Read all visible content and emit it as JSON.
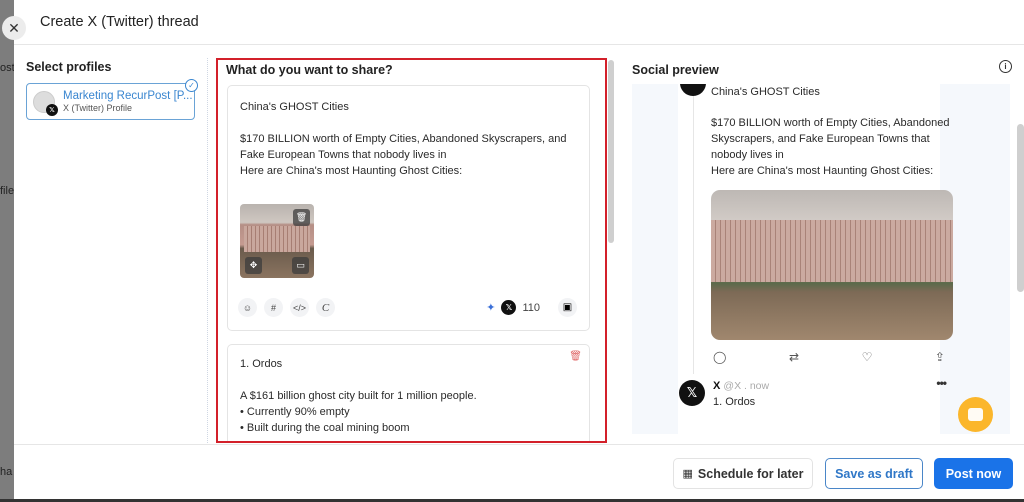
{
  "backdrop": {
    "fragments": [
      "ost",
      "file",
      "ha"
    ]
  },
  "modal": {
    "title": "Create X (Twitter) thread",
    "close_icon": "✕"
  },
  "profiles": {
    "section_title": "Select profiles",
    "items": [
      {
        "name": "Marketing RecurPost [P...",
        "type": "X (Twitter) Profile",
        "selected": true
      }
    ]
  },
  "composer": {
    "section_title": "What do you want to share?",
    "posts": [
      {
        "text": "China's GHOST Cities\n\n$170 BILLION worth of Empty Cities, Abandoned Skyscrapers, and Fake European Towns that nobody lives in\nHere are China's most Haunting Ghost Cities:",
        "char_count": "110",
        "tools": [
          "emoji-icon",
          "hashtag-icon",
          "code-icon",
          "canva-icon"
        ]
      },
      {
        "text": "1. Ordos\n\nA $161 billion ghost city built for 1 million people.\n• Currently 90% empty\n• Built during the coal mining boom"
      }
    ]
  },
  "preview": {
    "section_title": "Social preview",
    "tweet1": {
      "title": "China's GHOST Cities",
      "body": "$170 BILLION worth of Empty Cities, Abandoned Skyscrapers, and Fake European Towns that nobody lives in\nHere are China's most Haunting Ghost Cities:"
    },
    "tweet2": {
      "name": "X",
      "handle": "@X . now",
      "text": "1. Ordos"
    }
  },
  "footer": {
    "schedule_label": "Schedule for later",
    "draft_label": "Save as draft",
    "post_label": "Post now"
  },
  "colors": {
    "accent": "#1a73e8",
    "highlight_border": "#d3202a",
    "chat_fab": "#fbb62b"
  }
}
